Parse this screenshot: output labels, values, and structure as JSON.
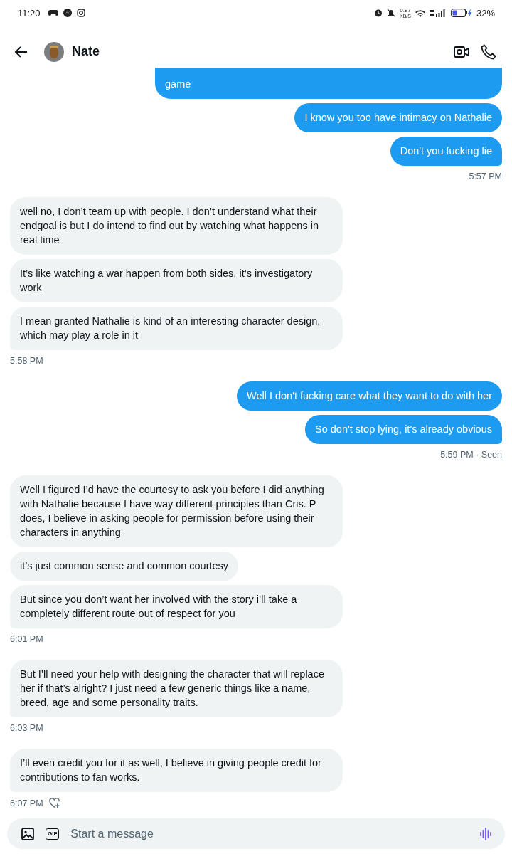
{
  "status_bar": {
    "time": "11:20",
    "speed": "0.87",
    "speed_unit": "KB/S",
    "battery": "32%"
  },
  "header": {
    "name": "Nate"
  },
  "groups": [
    {
      "kind": "sent",
      "cut_top": true,
      "messages": [
        "game",
        "I know you too have intimacy on Nathalie",
        "Don't you fucking lie"
      ],
      "meta": "5:57 PM"
    },
    {
      "kind": "received",
      "messages": [
        "well no, I don’t team up with people. I don’t understand what their endgoal is but I do intend to find out by watching what happens in real time",
        "It’s like watching a war happen from both sides, it’s investigatory work",
        "I mean granted Nathalie is kind of an interesting character design, which may play a role in it"
      ],
      "meta": "5:58 PM"
    },
    {
      "kind": "sent",
      "messages": [
        "Well I don't fucking care what they want to do with her",
        "So don't stop lying, it's already obvious"
      ],
      "meta": "5:59 PM · Seen"
    },
    {
      "kind": "received",
      "messages": [
        "Well I figured I’d have the courtesy to ask you before I did anything with Nathalie because I have way different principles than Cris. P does, I believe in asking people for permission before using their characters in anything",
        "it’s just common sense and common courtesy",
        "But since you don’t want her involved with the story i’ll take a completely different route out of respect for you"
      ],
      "meta": "6:01 PM"
    },
    {
      "kind": "received",
      "messages": [
        "But I’ll need your help with designing the character that will replace her if that’s alright? I just need a few generic things like a name, breed, age and some personality traits."
      ],
      "meta": "6:03 PM"
    },
    {
      "kind": "received",
      "messages": [
        "I’ll even credit you for it as well, I believe in giving people credit for contributions to fan works."
      ],
      "meta": "6:07 PM",
      "react": true
    }
  ],
  "composer": {
    "gif_label": "GIF",
    "placeholder": "Start a message"
  }
}
